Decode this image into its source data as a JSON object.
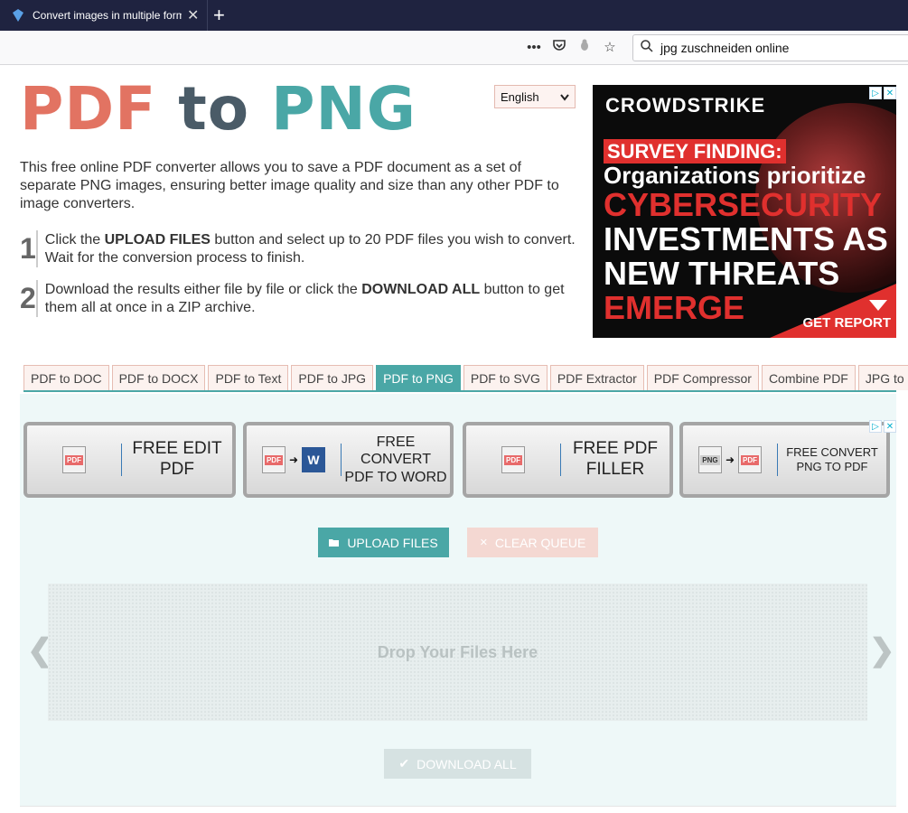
{
  "browser": {
    "tab_title": "Convert images in multiple form",
    "search_value": "jpg zuschneiden online"
  },
  "header": {
    "logo_pdf": "PDF",
    "logo_to": "to",
    "logo_png": "PNG",
    "language": "English"
  },
  "intro": "This free online PDF converter allows you to save a PDF document as a set of separate PNG images, ensuring better image quality and size than any other PDF to image converters.",
  "steps": [
    {
      "num": "1",
      "pre": "Click the ",
      "bold": "UPLOAD FILES",
      "post": " button and select up to 20 PDF files you wish to convert. Wait for the conversion process to finish."
    },
    {
      "num": "2",
      "pre": "Download the results either file by file or click the ",
      "bold": "DOWNLOAD ALL",
      "post": " button to get them all at once in a ZIP archive."
    }
  ],
  "ad_top": {
    "brand": "CROWDSTRIKE",
    "line1": "SURVEY FINDING:",
    "line2": "Organizations prioritize",
    "line3": "CYBERSECURITY",
    "line4a": "INVESTMENTS",
    "line4b": " AS",
    "line5a": "NEW THREATS ",
    "line5b": "EMERGE",
    "cta": "GET REPORT"
  },
  "tools": [
    {
      "label": "PDF to DOC",
      "active": false
    },
    {
      "label": "PDF to DOCX",
      "active": false
    },
    {
      "label": "PDF to Text",
      "active": false
    },
    {
      "label": "PDF to JPG",
      "active": false
    },
    {
      "label": "PDF to PNG",
      "active": true
    },
    {
      "label": "PDF to SVG",
      "active": false
    },
    {
      "label": "PDF Extractor",
      "active": false
    },
    {
      "label": "PDF Compressor",
      "active": false
    },
    {
      "label": "Combine PDF",
      "active": false
    },
    {
      "label": "JPG to PDF",
      "active": false
    }
  ],
  "ad_buttons": [
    {
      "l1": "FREE EDIT",
      "l2": "PDF"
    },
    {
      "l1": "FREE CONVERT",
      "l2": "PDF TO WORD"
    },
    {
      "l1": "FREE PDF",
      "l2": "FILLER"
    },
    {
      "l1": "FREE CONVERT",
      "l2": "PNG TO PDF"
    }
  ],
  "actions": {
    "upload": "UPLOAD FILES",
    "clear": "CLEAR QUEUE",
    "drop": "Drop Your Files Here",
    "download": "DOWNLOAD ALL"
  },
  "icons": {
    "doc_badge": "PDF",
    "png_badge": "PNG",
    "word_badge": "W"
  }
}
